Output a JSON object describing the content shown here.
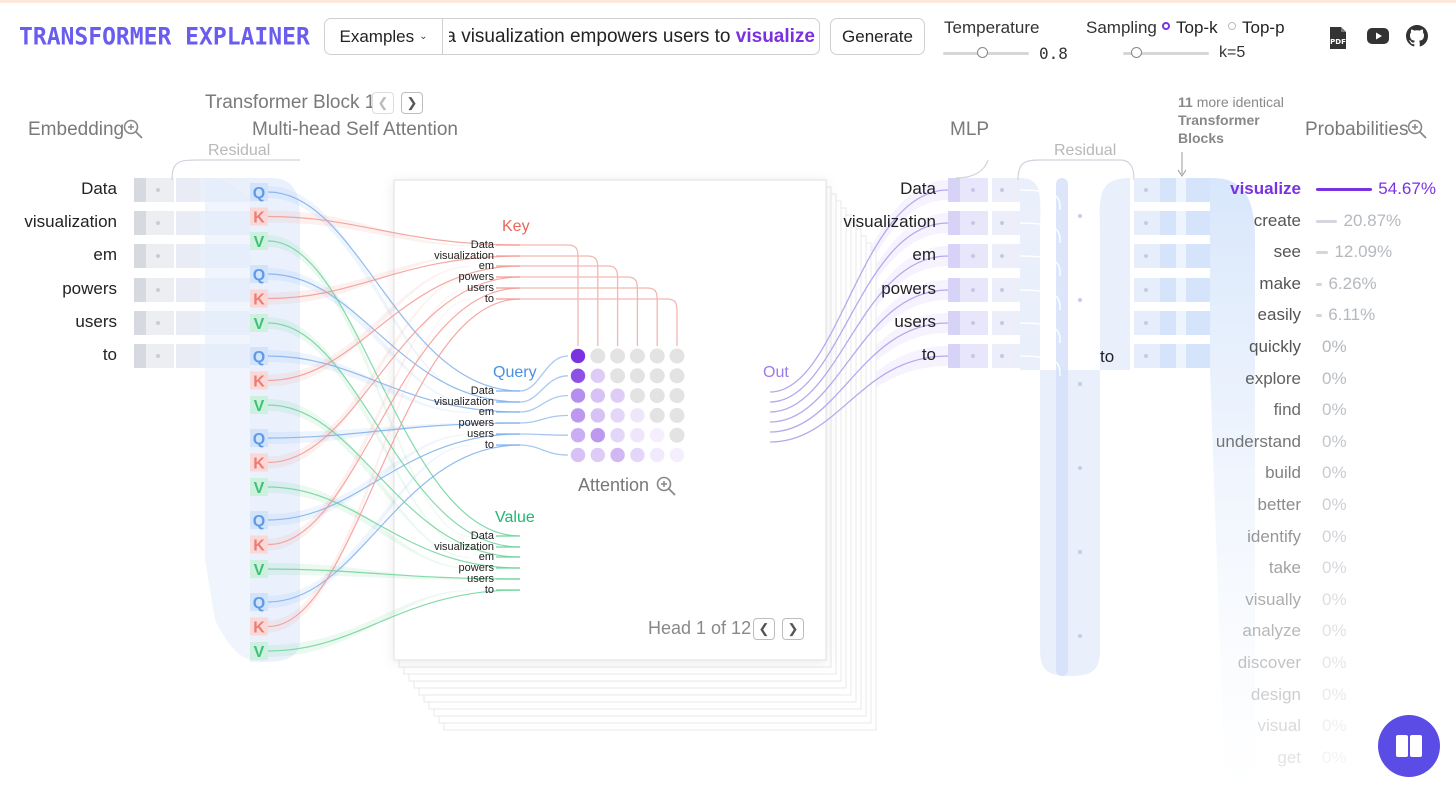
{
  "app": {
    "title": "Transformer Explainer"
  },
  "toolbar": {
    "examples_label": "Examples",
    "prompt_text": "Data visualization empowers users to",
    "prompt_prediction": "visualize",
    "generate_label": "Generate",
    "temperature_label": "Temperature",
    "temperature_value": "0.8",
    "temperature_fraction": 0.45,
    "sampling_label": "Sampling",
    "sampling_options": [
      "Top-k",
      "Top-p"
    ],
    "sampling_selected": "Top-k",
    "k_value": "k=5",
    "k_fraction": 0.15,
    "icons": [
      "pdf-icon",
      "youtube-icon",
      "github-icon"
    ]
  },
  "header": {
    "block_title": "Transformer Block 1",
    "embedding_label": "Embedding",
    "attention_label": "Multi-head Self Attention",
    "residual_label": "Residual",
    "mlp_label": "MLP",
    "residual_label_2": "Residual",
    "more_blocks_count": "11",
    "more_blocks_text": "more identical",
    "more_blocks_bold": "Transformer Blocks",
    "probabilities_label": "Probabilities"
  },
  "tokens": [
    "Data",
    "visualization",
    "em",
    "powers",
    "users",
    "to"
  ],
  "qkv_letters": [
    "Q",
    "K",
    "V"
  ],
  "attention": {
    "key_label": "Key",
    "query_label": "Query",
    "value_label": "Value",
    "out_label": "Out",
    "matrix_label": "Attention",
    "head_label": "Head 1 of 12",
    "matrix_weights": [
      [
        1.0,
        0,
        0,
        0,
        0,
        0
      ],
      [
        0.85,
        0.25,
        0,
        0,
        0,
        0
      ],
      [
        0.55,
        0.3,
        0.25,
        0,
        0,
        0
      ],
      [
        0.5,
        0.3,
        0.2,
        0.12,
        0,
        0
      ],
      [
        0.4,
        0.5,
        0.2,
        0.12,
        0.08,
        0
      ],
      [
        0.3,
        0.25,
        0.35,
        0.2,
        0.1,
        0.05
      ]
    ]
  },
  "mlp_output_token": "to",
  "probabilities": [
    {
      "word": "visualize",
      "value": "54.67%",
      "fraction": 0.5467
    },
    {
      "word": "create",
      "value": "20.87%",
      "fraction": 0.2087
    },
    {
      "word": "see",
      "value": "12.09%",
      "fraction": 0.1209
    },
    {
      "word": "make",
      "value": "6.26%",
      "fraction": 0.0626
    },
    {
      "word": "easily",
      "value": "6.11%",
      "fraction": 0.0611
    },
    {
      "word": "quickly",
      "value": "0%",
      "fraction": 0
    },
    {
      "word": "explore",
      "value": "0%",
      "fraction": 0
    },
    {
      "word": "find",
      "value": "0%",
      "fraction": 0
    },
    {
      "word": "understand",
      "value": "0%",
      "fraction": 0
    },
    {
      "word": "build",
      "value": "0%",
      "fraction": 0
    },
    {
      "word": "better",
      "value": "0%",
      "fraction": 0
    },
    {
      "word": "identify",
      "value": "0%",
      "fraction": 0
    },
    {
      "word": "take",
      "value": "0%",
      "fraction": 0
    },
    {
      "word": "visually",
      "value": "0%",
      "fraction": 0
    },
    {
      "word": "analyze",
      "value": "0%",
      "fraction": 0
    },
    {
      "word": "discover",
      "value": "0%",
      "fraction": 0
    },
    {
      "word": "design",
      "value": "0%",
      "fraction": 0
    },
    {
      "word": "visual",
      "value": "0%",
      "fraction": 0
    },
    {
      "word": "get",
      "value": "0%",
      "fraction": 0
    }
  ],
  "colors": {
    "accent": "#7a32e0",
    "query": "#7fb0ec",
    "key": "#f29a93",
    "value": "#6fd39a",
    "brand": "#6b5cf0",
    "fab": "#5b4ce6"
  }
}
